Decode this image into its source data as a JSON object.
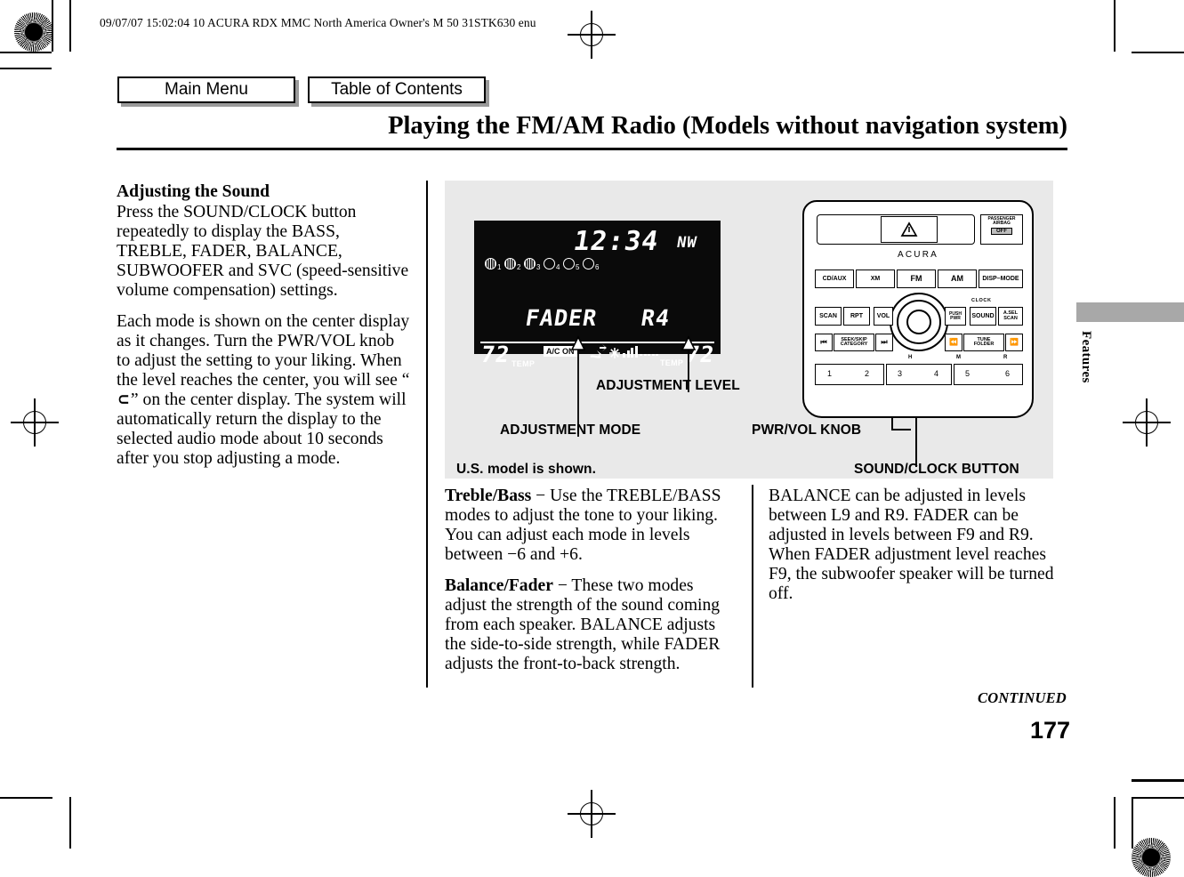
{
  "header": {
    "job_line": "09/07/07 15:02:04    10 ACURA RDX MMC North America Owner's M 50 31STK630 enu"
  },
  "nav": {
    "main_menu": "Main Menu",
    "table_of_contents": "Table of Contents"
  },
  "page": {
    "title": "Playing the FM/AM Radio (Models without navigation system)",
    "continued": "CONTINUED",
    "number": "177",
    "side_tab": "Features"
  },
  "left_column": {
    "heading": "Adjusting the Sound",
    "para1": "Press the SOUND/CLOCK button repeatedly to display the BASS, TREBLE, FADER, BALANCE, SUBWOOFER and SVC (speed-sensitive volume compensation) settings.",
    "para2_a": "Each mode is shown on the center display as it changes. Turn the PWR/VOL knob to adjust the setting to your liking. When the level reaches the center, you will see “",
    "para2_glyph": "⊂",
    "para2_b": "” on the center display. The system will automatically return the display to the selected audio mode about 10 seconds after you stop adjusting a mode."
  },
  "middle_column": {
    "treble_bass_term": "Treble/Bass",
    "treble_bass_dash": "−",
    "treble_bass_text": "Use the TREBLE/BASS modes to adjust the tone to your liking. You can adjust each mode in levels between −6 and +6.",
    "balance_fader_term": "Balance/Fader",
    "balance_fader_dash": "−",
    "balance_fader_text": "These two modes adjust the strength of the sound coming from each speaker. BALANCE adjusts the side-to-side strength, while FADER adjusts the front-to-back strength."
  },
  "right_column": {
    "para": "BALANCE can be adjusted in levels between L9 and R9. FADER can be adjusted in levels between F9 and R9. When FADER adjustment level reaches F9, the subwoofer speaker will be turned off."
  },
  "figure": {
    "caption_adjustment_level": "ADJUSTMENT LEVEL",
    "caption_adjustment_mode": "ADJUSTMENT MODE",
    "caption_pwr_vol_knob": "PWR/VOL KNOB",
    "caption_sound_clock_button": "SOUND/CLOCK BUTTON",
    "caption_us_model": "U.S. model is shown.",
    "lcd": {
      "clock": "12:34",
      "direction": "NW",
      "disc_count": 6,
      "discs_active": [
        1,
        2,
        3
      ],
      "disc_labels": [
        "1",
        "2",
        "3",
        "4",
        "5",
        "6"
      ],
      "mode": "FADER",
      "level": "R4",
      "temp_left": "72",
      "temp_left_label": "TEMP",
      "temp_right": "72",
      "temp_right_label": "TEMP",
      "ac_status": "A/C ON"
    },
    "faceplate": {
      "brand": "ACURA",
      "hazard_icon": "hazard-triangle-icon",
      "airbag_label_line1": "PASSENGER",
      "airbag_label_line2": "AIRBAG",
      "airbag_state": "OFF",
      "source_buttons": [
        "CD/AUX",
        "XM",
        "FM",
        "AM",
        "DISP–MODE"
      ],
      "control_row": [
        "SCAN",
        "RPT",
        "VOL",
        "PWR",
        "SOUND",
        "A.SEL\nSCAN"
      ],
      "pwr_label_line1": "PUSH",
      "pwr_label_line2": "PWR",
      "clock_label": "CLOCK",
      "asel_line1": "A.SEL",
      "asel_line2": "SCAN",
      "seek_line1": "SEEK/SKIP",
      "seek_line2": "CATEGORY",
      "tune_line1": "TUNE",
      "tune_line2": "FOLDER",
      "preset_buttons": [
        "1",
        "2",
        "3",
        "4",
        "5",
        "6"
      ],
      "preset_markers": [
        "H",
        "M",
        "R"
      ]
    }
  },
  "colors": {
    "figure_background": "#e9e9e9",
    "lcd_background": "#0a0a0a",
    "lcd_text": "#ffffff",
    "tab_gray": "#a8a8a8",
    "button_shadow": "#9a9a9a"
  }
}
